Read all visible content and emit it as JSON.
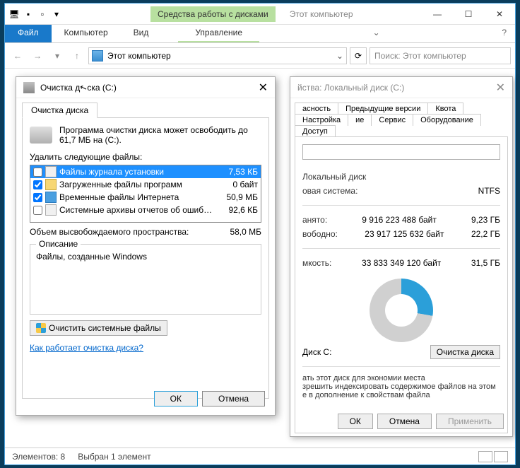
{
  "explorer": {
    "context_tab": "Средства работы с дисками",
    "window_title": "Этот компьютер",
    "tabs": {
      "file": "Файл",
      "computer": "Компьютер",
      "view": "Вид",
      "manage": "Управление"
    },
    "address": "Этот компьютер",
    "search_placeholder": "Поиск: Этот компьютер",
    "status_items": "Элементов: 8",
    "status_selected": "Выбран 1 элемент"
  },
  "props": {
    "title": "йства: Локальный диск (C:)",
    "tabs_row1": [
      "асность",
      "Предыдущие версии",
      "Квота",
      "Настройка"
    ],
    "tabs_row2": [
      "ие",
      "Сервис",
      "Оборудование",
      "Доступ"
    ],
    "type_label": "Локальный диск",
    "fs_label": "овая система:",
    "fs_value": "NTFS",
    "used_label": "анято:",
    "used_bytes": "9 916 223 488 байт",
    "used_gb": "9,23 ГБ",
    "free_label": "вободно:",
    "free_bytes": "23 917 125 632 байт",
    "free_gb": "22,2 ГБ",
    "cap_label": "мкость:",
    "cap_bytes": "33 833 349 120 байт",
    "cap_gb": "31,5 ГБ",
    "disk_caption": "Диск C:",
    "cleanup_btn": "Очистка диска",
    "note1": "ать этот диск для экономии места",
    "note2": "зрешить индексировать содержимое файлов на этом",
    "note3": "е в дополнение к свойствам файла",
    "ok": "ОК",
    "cancel": "Отмена",
    "apply": "Применить"
  },
  "cleanup": {
    "title_pre": "Очистка д",
    "title_post": "ска  (C:)",
    "tab": "Очистка диска",
    "intro": "Программа очистки диска может освободить до 61,7 МБ на (C:).",
    "list_label": "Удалить следующие файлы:",
    "items": [
      {
        "checked": false,
        "name": "Файлы журнала установки",
        "size": "7,53 КБ",
        "selected": true,
        "icon": "txt"
      },
      {
        "checked": true,
        "name": "Загруженные файлы программ",
        "size": "0 байт",
        "selected": false,
        "icon": "folder"
      },
      {
        "checked": true,
        "name": "Временные файлы Интернета",
        "size": "50,9 МБ",
        "selected": false,
        "icon": "ie"
      },
      {
        "checked": false,
        "name": "Системные архивы отчетов об ошиб…",
        "size": "92,6 КБ",
        "selected": false,
        "icon": "txt"
      }
    ],
    "total_label": "Объем высвобождаемого пространства:",
    "total_value": "58,0 МБ",
    "group_legend": "Описание",
    "description": "Файлы, созданные Windows",
    "sys_btn": "Очистить системные файлы",
    "how_link": "Как работает очистка диска?",
    "ok": "ОК",
    "cancel": "Отмена"
  }
}
